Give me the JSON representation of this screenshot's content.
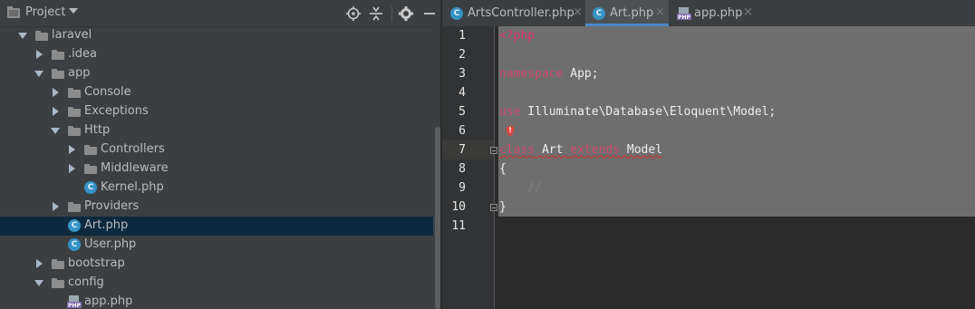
{
  "project_panel": {
    "title": "Project",
    "tree": [
      {
        "label": "laravel",
        "type": "folder",
        "expanded": true,
        "depth": 0
      },
      {
        "label": ".idea",
        "type": "folder",
        "expanded": false,
        "depth": 1
      },
      {
        "label": "app",
        "type": "folder",
        "expanded": true,
        "depth": 1
      },
      {
        "label": "Console",
        "type": "folder",
        "expanded": false,
        "depth": 2
      },
      {
        "label": "Exceptions",
        "type": "folder",
        "expanded": false,
        "depth": 2
      },
      {
        "label": "Http",
        "type": "folder",
        "expanded": true,
        "depth": 2
      },
      {
        "label": "Controllers",
        "type": "folder",
        "expanded": false,
        "depth": 3
      },
      {
        "label": "Middleware",
        "type": "folder",
        "expanded": false,
        "depth": 3
      },
      {
        "label": "Kernel.php",
        "type": "class",
        "depth": 3
      },
      {
        "label": "Providers",
        "type": "folder",
        "expanded": false,
        "depth": 2
      },
      {
        "label": "Art.php",
        "type": "class",
        "depth": 2,
        "selected": true
      },
      {
        "label": "User.php",
        "type": "class",
        "depth": 2
      },
      {
        "label": "bootstrap",
        "type": "folder",
        "expanded": false,
        "depth": 1
      },
      {
        "label": "config",
        "type": "folder",
        "expanded": true,
        "depth": 1
      },
      {
        "label": "app.php",
        "type": "php",
        "depth": 2
      }
    ]
  },
  "tabs": [
    {
      "label": "ArtsController.php",
      "icon": "class-icon",
      "close": "×",
      "active": false
    },
    {
      "label": "Art.php",
      "icon": "class-icon",
      "close": "×",
      "active": true
    },
    {
      "label": "app.php",
      "icon": "php-file-icon",
      "close": "×",
      "active": false
    }
  ],
  "editor": {
    "line_numbers": [
      "1",
      "2",
      "3",
      "4",
      "5",
      "6",
      "7",
      "8",
      "9",
      "10",
      "11"
    ],
    "lines": {
      "l1_tag": "<?php",
      "l3_kw": "namespace",
      "l3_rest": " App;",
      "l5_kw": "use",
      "l5_rest": " Illuminate\\Database\\Eloquent\\Model;",
      "l7_kw1": "class",
      "l7_name": " Art ",
      "l7_kw2": "extends",
      "l7_rest": " Model",
      "l8": "{",
      "l9": "    //",
      "l10": "}"
    }
  },
  "colors": {
    "panel_bg": "#3c3f41",
    "editor_bg": "#2b2b2b",
    "selection": "#6e6e6e",
    "keyword": "#cc7832",
    "active_tab_underline": "#4a88c7"
  }
}
